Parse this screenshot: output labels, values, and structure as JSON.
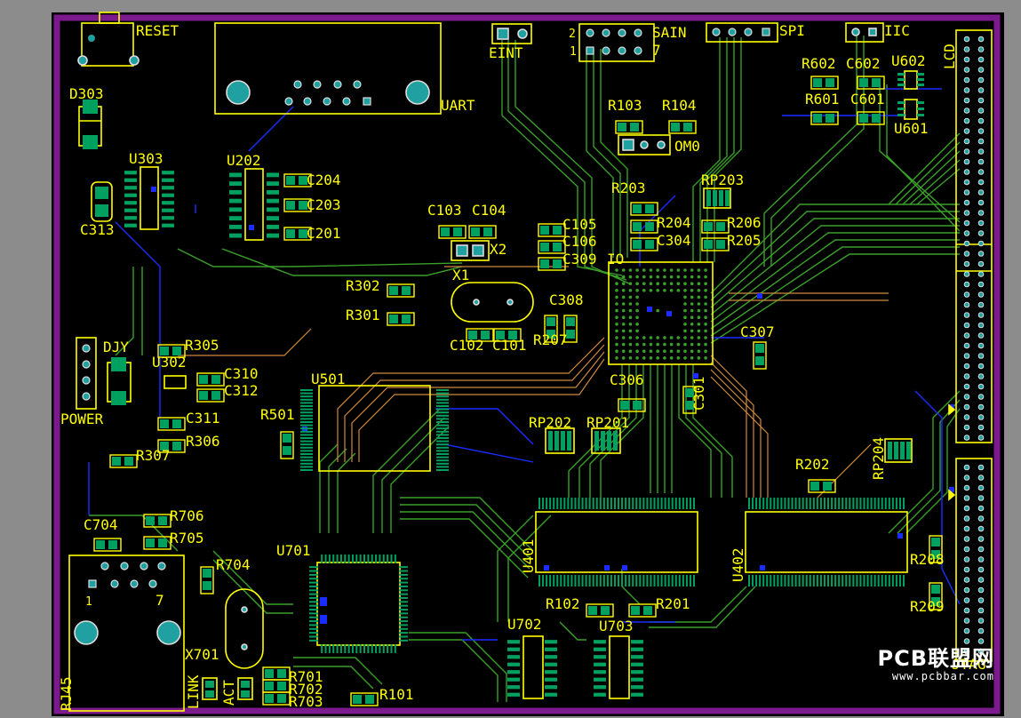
{
  "labels": {
    "reset": "RESET",
    "uart": "UART",
    "eint": "EINT",
    "pin2": "2",
    "pin1": "1",
    "sain": "SAIN",
    "pin7": "7",
    "spi": "SPI",
    "iic": "IIC",
    "lcd": "LCD",
    "d303": "D303",
    "u303": "U303",
    "c313": "C313",
    "u202": "U202",
    "c204": "C204",
    "c203": "C203",
    "c201": "C201",
    "c103": "C103",
    "c104": "C104",
    "x2": "X2",
    "c105": "C105",
    "c106": "C106",
    "c309": "C309",
    "io": "IO",
    "r103": "R103",
    "r104": "R104",
    "om0": "OM0",
    "r203": "R203",
    "rp203": "RP203",
    "r204": "R204",
    "r206": "R206",
    "c304": "C304",
    "r205": "R205",
    "r602": "R602",
    "c602": "C602",
    "u602": "U602",
    "r601": "R601",
    "c601": "C601",
    "u601": "U601",
    "r302": "R302",
    "r301": "R301",
    "x1": "X1",
    "c308": "C308",
    "c102": "C102",
    "c101": "C101",
    "r207": "R207",
    "c307": "C307",
    "djy": "DJY",
    "r305": "R305",
    "u302": "U302",
    "c310": "C310",
    "c312": "C312",
    "power": "POWER",
    "c311": "C311",
    "r306": "R306",
    "r307": "R307",
    "u501": "U501",
    "r501": "R501",
    "c306": "C306",
    "c301": "C301",
    "rp202": "RP202",
    "rp201": "RP201",
    "rp204": "RP204",
    "r202": "R202",
    "c704": "C704",
    "r706": "R706",
    "r705": "R705",
    "r704": "R704",
    "u701": "U701",
    "u401": "U401",
    "u402": "U402",
    "r208": "R208",
    "r209": "R209",
    "jtag": "JTAG",
    "rj45": "RJ45",
    "pin1b": "1",
    "pin7b": "7",
    "x701": "X701",
    "link": "LINK",
    "act": "ACT",
    "r701": "R701",
    "r702": "R702",
    "r703": "R703",
    "r101": "R101",
    "u702": "U702",
    "u703": "U703",
    "r102": "R102",
    "r201": "R201"
  },
  "watermark": {
    "logo": "PCB联盟网",
    "url": "www.pcbbar.com"
  },
  "colors": {
    "background": "#000000",
    "board_outline": "#7a1a8c",
    "silkscreen": "#ffff00",
    "pad": "#00a060",
    "top_trace": "#3aa02a",
    "bottom_trace": "#1a2cff",
    "inner_trace": "#d08a40",
    "via": "#20a0a0"
  }
}
